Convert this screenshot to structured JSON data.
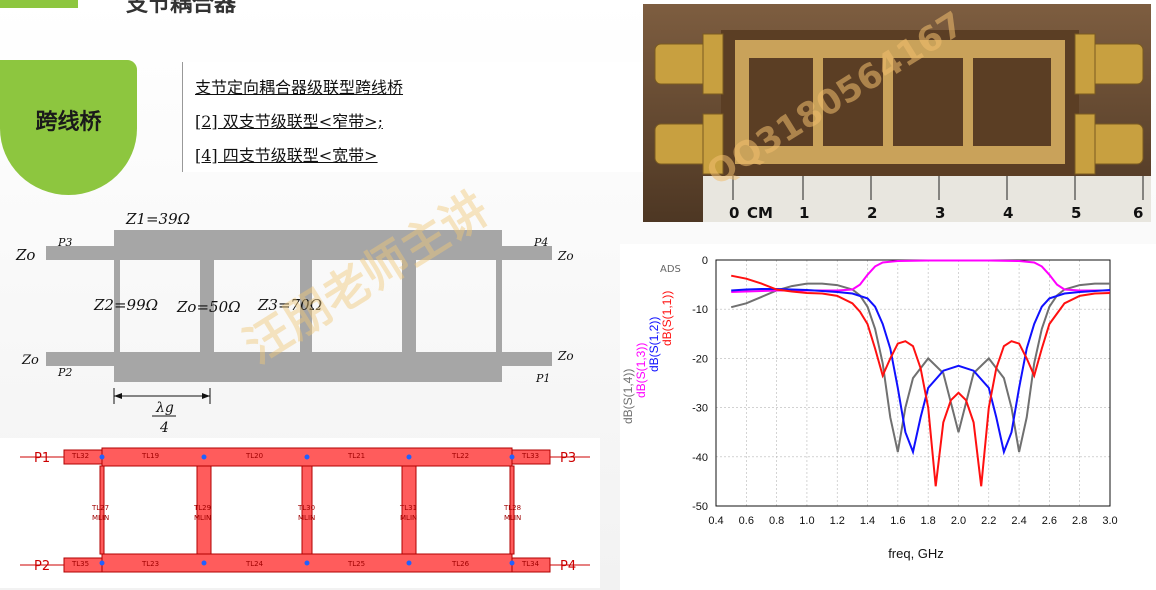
{
  "header": {
    "title": "支节耦合器"
  },
  "badge": {
    "label": "跨线桥"
  },
  "menu": {
    "items": [
      {
        "label": "支节定向耦合器级联型跨线桥"
      },
      {
        "label": "[2] 双支节级联型<窄带>;"
      },
      {
        "label": "[4] 四支节级联型<宽带>"
      }
    ]
  },
  "photo": {
    "ruler_labels": [
      "0",
      "CM",
      "1",
      "2",
      "3",
      "4",
      "5",
      "6"
    ]
  },
  "schematic": {
    "z1": "Z1=39Ω",
    "z2": "Z2=99Ω",
    "zo_mid": "Zo=50Ω",
    "z3": "Z3=70Ω",
    "zo": "Zo",
    "ports": {
      "p1": "P1",
      "p2": "P2",
      "p3": "P3",
      "p4": "P4"
    },
    "lambda": "λg",
    "lambda_den": "4"
  },
  "layout": {
    "ports": [
      "P1",
      "P2",
      "P3",
      "P4"
    ],
    "top_lines": [
      "TL32",
      "TL19",
      "TL20",
      "TL21",
      "TL22",
      "TL33"
    ],
    "bottom_lines": [
      "TL35",
      "TL23",
      "TL24",
      "TL25",
      "TL26",
      "TL34"
    ],
    "stubs": [
      "TL27",
      "TL29",
      "TL30",
      "TL31",
      "TL28"
    ],
    "type": "MLIN"
  },
  "watermark": {
    "text1": "汪朋老师主讲",
    "text2": "QQ3180564167"
  },
  "chart_data": {
    "type": "line",
    "tag": "ADS",
    "xlabel": "freq, GHz",
    "ylabel_series": [
      "dB(S(1,4))",
      "dB(S(1,3))",
      "dB(S(1,2))",
      "dB(S(1,1))"
    ],
    "xlim": [
      0.4,
      3.0
    ],
    "ylim": [
      -50,
      0
    ],
    "xticks": [
      0.4,
      0.6,
      0.8,
      1.0,
      1.2,
      1.4,
      1.6,
      1.8,
      2.0,
      2.2,
      2.4,
      2.6,
      2.8,
      3.0
    ],
    "yticks": [
      0,
      -10,
      -20,
      -30,
      -40,
      -50
    ],
    "series": [
      {
        "name": "dB(S(1,4))",
        "color": "#707070",
        "x": [
          0.5,
          0.6,
          0.7,
          0.8,
          0.9,
          1.0,
          1.1,
          1.2,
          1.3,
          1.35,
          1.4,
          1.45,
          1.5,
          1.55,
          1.6,
          1.65,
          1.7,
          1.8,
          1.9,
          2.0,
          2.1,
          2.2,
          2.3,
          2.35,
          2.4,
          2.45,
          2.5,
          2.55,
          2.6,
          2.65,
          2.7,
          2.8,
          2.9,
          3.0
        ],
        "y": [
          -9.6,
          -8.8,
          -7.5,
          -6.2,
          -5.3,
          -4.8,
          -4.8,
          -5.1,
          -6.0,
          -7.2,
          -9.5,
          -14,
          -21,
          -32,
          -39,
          -30,
          -24,
          -20,
          -23,
          -35,
          -23,
          -20,
          -24,
          -30,
          -39,
          -32,
          -21,
          -14,
          -9.5,
          -7.2,
          -6.0,
          -5.1,
          -4.8,
          -4.8
        ]
      },
      {
        "name": "dB(S(1,3))",
        "color": "#ff00ff",
        "x": [
          0.5,
          0.6,
          0.7,
          0.8,
          0.9,
          1.0,
          1.1,
          1.2,
          1.3,
          1.35,
          1.4,
          1.45,
          1.5,
          1.6,
          1.8,
          2.0,
          2.2,
          2.4,
          2.5,
          2.55,
          2.6,
          2.65,
          2.7,
          2.8,
          2.9,
          3.0
        ],
        "y": [
          -6.5,
          -6.4,
          -6.3,
          -6.2,
          -6.2,
          -6.2,
          -6.2,
          -6.2,
          -6.0,
          -5.0,
          -3.0,
          -1.3,
          -0.5,
          -0.2,
          -0.1,
          -0.1,
          -0.1,
          -0.2,
          -0.5,
          -1.3,
          -3.0,
          -5.0,
          -6.0,
          -6.2,
          -6.2,
          -6.2
        ]
      },
      {
        "name": "dB(S(1,2))",
        "color": "#1010ff",
        "x": [
          0.5,
          0.6,
          0.7,
          0.8,
          0.9,
          1.0,
          1.1,
          1.2,
          1.3,
          1.4,
          1.45,
          1.5,
          1.55,
          1.6,
          1.65,
          1.7,
          1.75,
          1.8,
          1.9,
          2.0,
          2.1,
          2.2,
          2.25,
          2.3,
          2.35,
          2.4,
          2.45,
          2.5,
          2.55,
          2.6,
          2.7,
          2.8,
          2.9,
          3.0
        ],
        "y": [
          -6.2,
          -6.0,
          -5.9,
          -5.9,
          -6.0,
          -6.1,
          -6.3,
          -6.5,
          -6.8,
          -7.8,
          -9.5,
          -13,
          -18,
          -26,
          -35,
          -39,
          -32,
          -26,
          -22.5,
          -21.5,
          -22.5,
          -26,
          -32,
          -39,
          -35,
          -26,
          -18,
          -13,
          -9.5,
          -7.8,
          -6.8,
          -6.5,
          -6.3,
          -6.1
        ]
      },
      {
        "name": "dB(S(1,1))",
        "color": "#ff1010",
        "x": [
          0.5,
          0.6,
          0.7,
          0.8,
          0.9,
          1.0,
          1.1,
          1.2,
          1.3,
          1.35,
          1.4,
          1.45,
          1.5,
          1.55,
          1.6,
          1.65,
          1.7,
          1.75,
          1.8,
          1.85,
          1.9,
          1.95,
          2.0,
          2.05,
          2.1,
          2.15,
          2.2,
          2.25,
          2.3,
          2.35,
          2.4,
          2.45,
          2.5,
          2.55,
          2.6,
          2.7,
          2.8,
          2.9,
          3.0
        ],
        "y": [
          -3.2,
          -3.8,
          -4.8,
          -6.0,
          -6.4,
          -6.7,
          -6.8,
          -7.3,
          -8.8,
          -10.5,
          -13,
          -18,
          -23.5,
          -20,
          -17,
          -16.5,
          -17.5,
          -22,
          -30,
          -46,
          -33,
          -28.5,
          -27,
          -28.5,
          -33,
          -46,
          -30,
          -22,
          -17.5,
          -16.5,
          -17,
          -20,
          -23.5,
          -18,
          -13,
          -8.8,
          -7.3,
          -6.8,
          -6.7
        ]
      }
    ]
  }
}
